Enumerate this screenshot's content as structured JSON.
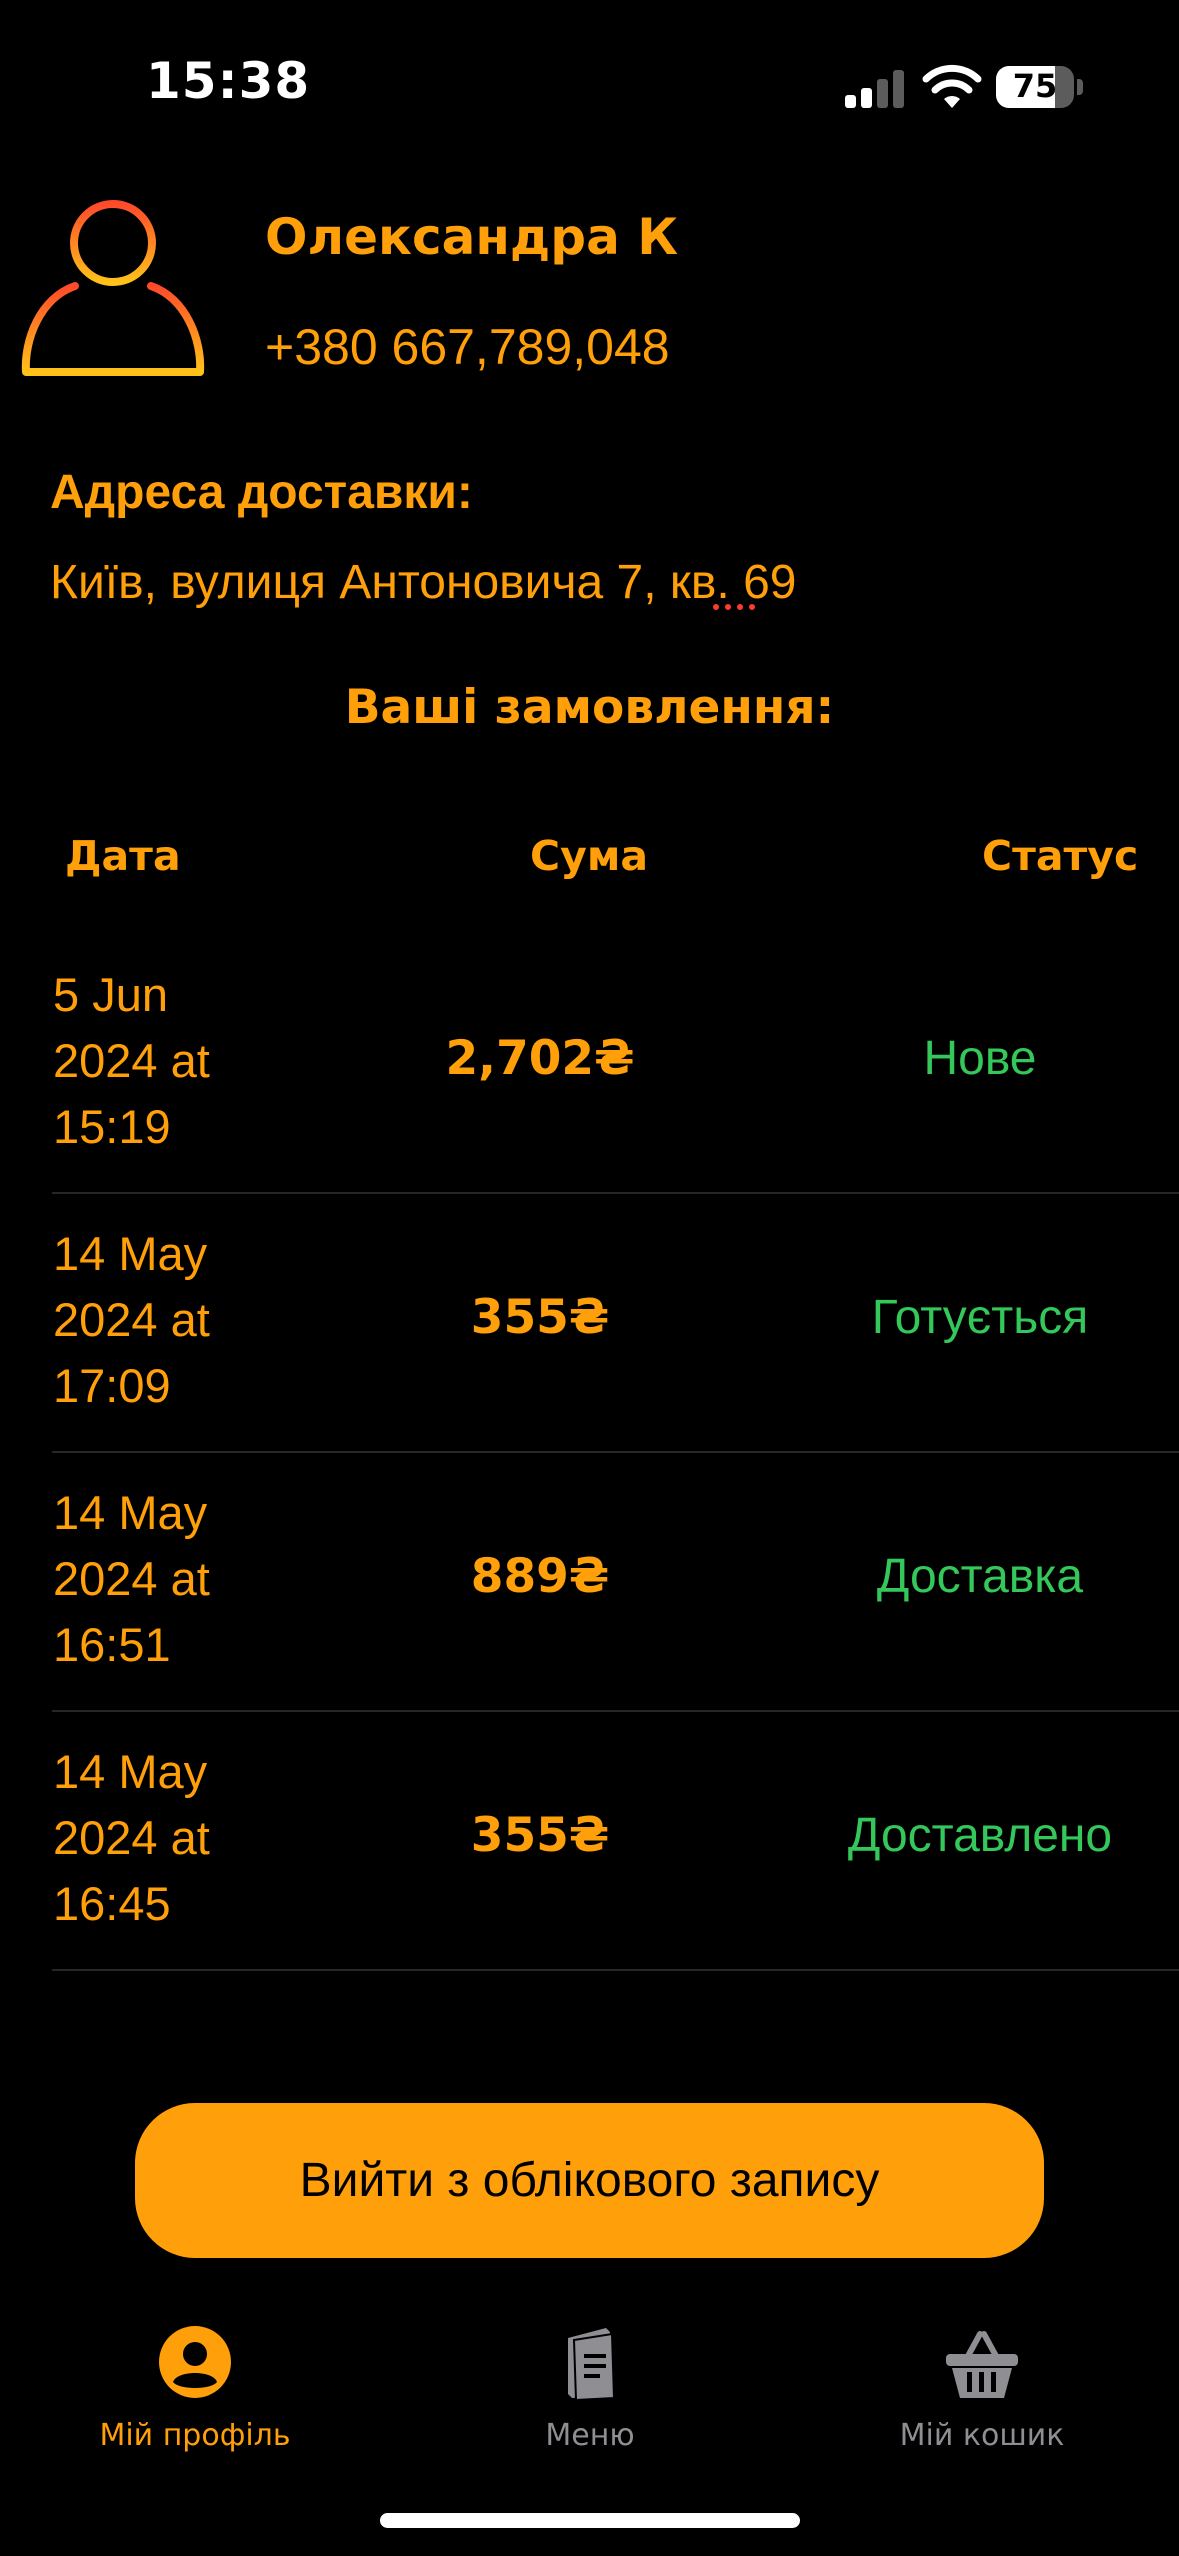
{
  "status_bar": {
    "time": "15:38",
    "battery": "75"
  },
  "profile": {
    "name": "Олександра К",
    "phone": "+380  667,789,048",
    "address_label": "Адреса доставки:",
    "address_value": "Київ, вулиця Антоновича 7,  кв. 69"
  },
  "orders": {
    "title": "Ваші замовлення:",
    "columns": {
      "date": "Дата",
      "sum": "Сума",
      "status": "Статус"
    },
    "rows": [
      {
        "date_line1": "5 Jun",
        "date_line2": "2024 at",
        "date_line3": "15:19",
        "sum": "2,702₴",
        "status": "Нове"
      },
      {
        "date_line1": "14 May",
        "date_line2": "2024 at",
        "date_line3": "17:09",
        "sum": "355₴",
        "status": "Готується"
      },
      {
        "date_line1": "14 May",
        "date_line2": "2024 at",
        "date_line3": "16:51",
        "sum": "889₴",
        "status": "Доставка"
      },
      {
        "date_line1": "14 May",
        "date_line2": "2024 at",
        "date_line3": "16:45",
        "sum": "355₴",
        "status": "Доставлено"
      }
    ]
  },
  "logout_label": "Вийти з облікового запису",
  "tabs": [
    {
      "label": "Мій профіль",
      "icon": "person-circle-icon",
      "active": true
    },
    {
      "label": "Меню",
      "icon": "menu-book-icon",
      "active": false
    },
    {
      "label": "Мій кошик",
      "icon": "basket-icon",
      "active": false
    }
  ],
  "colors": {
    "accent": "#FF9F0A",
    "status_green": "#34C759",
    "inactive_tab": "#8E8E93",
    "background": "#000000"
  }
}
